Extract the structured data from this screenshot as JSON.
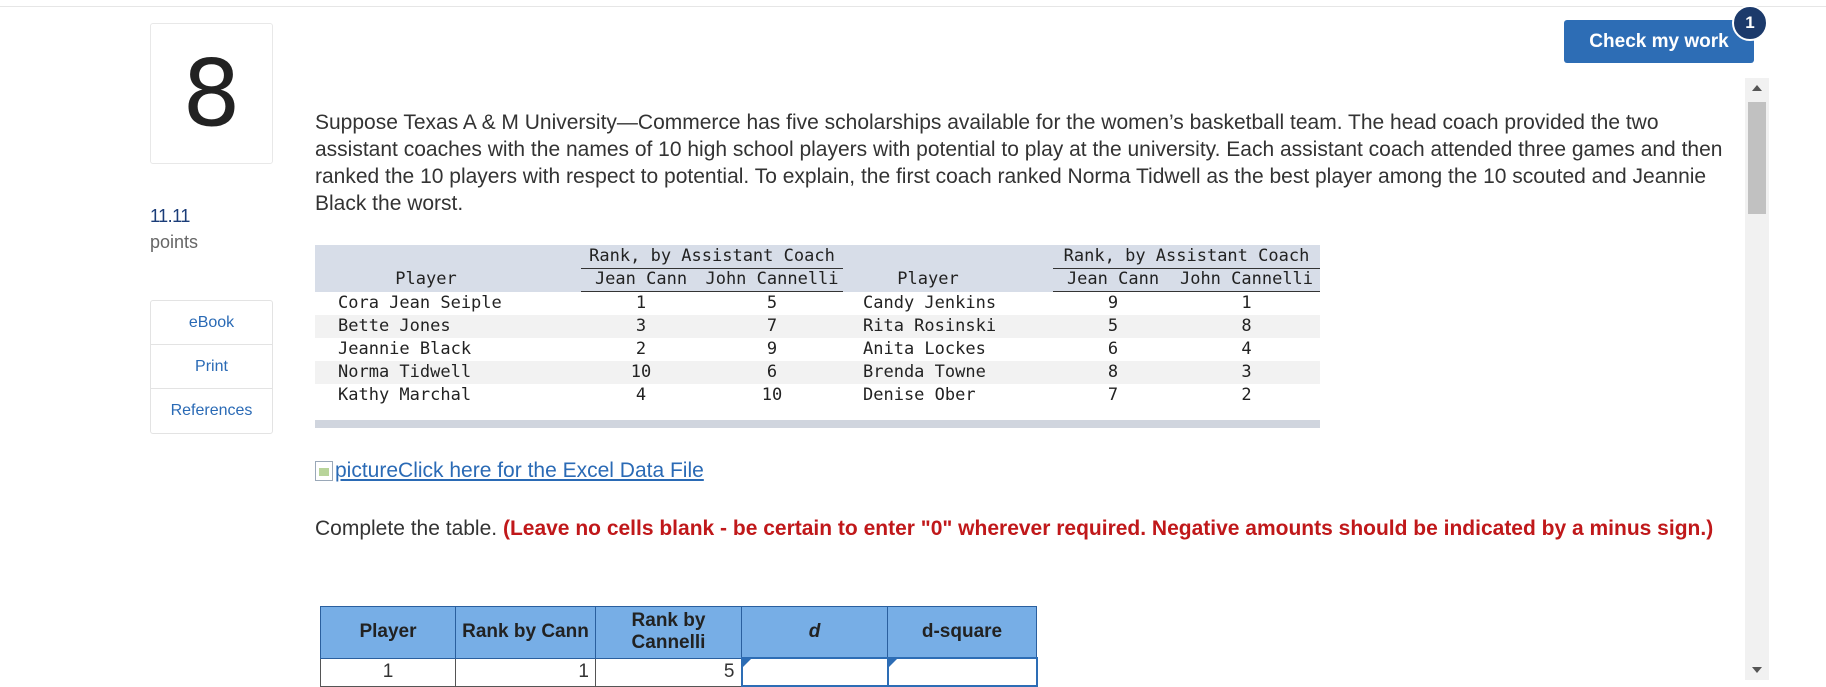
{
  "question": {
    "number": "8",
    "points_value": "11.11",
    "points_label": "points",
    "text": "Suppose Texas A & M University—Commerce has five scholarships available for the women’s basketball team. The head coach provided the two assistant coaches with the names of 10 high school players with potential to play at the university. Each assistant coach attended three games and then ranked the 10 players with respect to potential. To explain, the first coach ranked Norma Tidwell as the best player among the 10 scouted and Jeannie Black the worst."
  },
  "sidenav": {
    "items": [
      "eBook",
      "Print",
      "References"
    ]
  },
  "check_button": {
    "label": "Check my work",
    "badge": "1"
  },
  "data_table": {
    "group_header": "Rank, by Assistant Coach",
    "col_player": "Player",
    "col_cann": "Jean Cann",
    "col_cannelli": "John Cannelli",
    "left_rows": [
      [
        "Cora Jean Seiple",
        "1",
        "5"
      ],
      [
        "Bette Jones",
        "3",
        "7"
      ],
      [
        "Jeannie Black",
        "2",
        "9"
      ],
      [
        "Norma Tidwell",
        "10",
        "6"
      ],
      [
        "Kathy Marchal",
        "4",
        "10"
      ]
    ],
    "right_rows": [
      [
        "Candy Jenkins",
        "9",
        "1"
      ],
      [
        "Rita Rosinski",
        "5",
        "8"
      ],
      [
        "Anita Lockes",
        "6",
        "4"
      ],
      [
        "Brenda Towne",
        "8",
        "3"
      ],
      [
        "Denise Ober",
        "7",
        "2"
      ]
    ]
  },
  "excel_link": {
    "text": "pictureClick here for the Excel Data File"
  },
  "instructions": {
    "lead": "Complete the table. ",
    "bold_red": "(Leave no cells blank - be certain to enter \"0\" wherever required. Negative amounts should be indicated by a minus sign.)"
  },
  "answer_table": {
    "headers": [
      "Player",
      "Rank by Cann",
      "Rank by Cannelli",
      "d",
      "d-square"
    ],
    "rows": [
      {
        "player": "1",
        "cann": "1",
        "cannelli": "5",
        "d": "",
        "dsq": ""
      }
    ]
  }
}
